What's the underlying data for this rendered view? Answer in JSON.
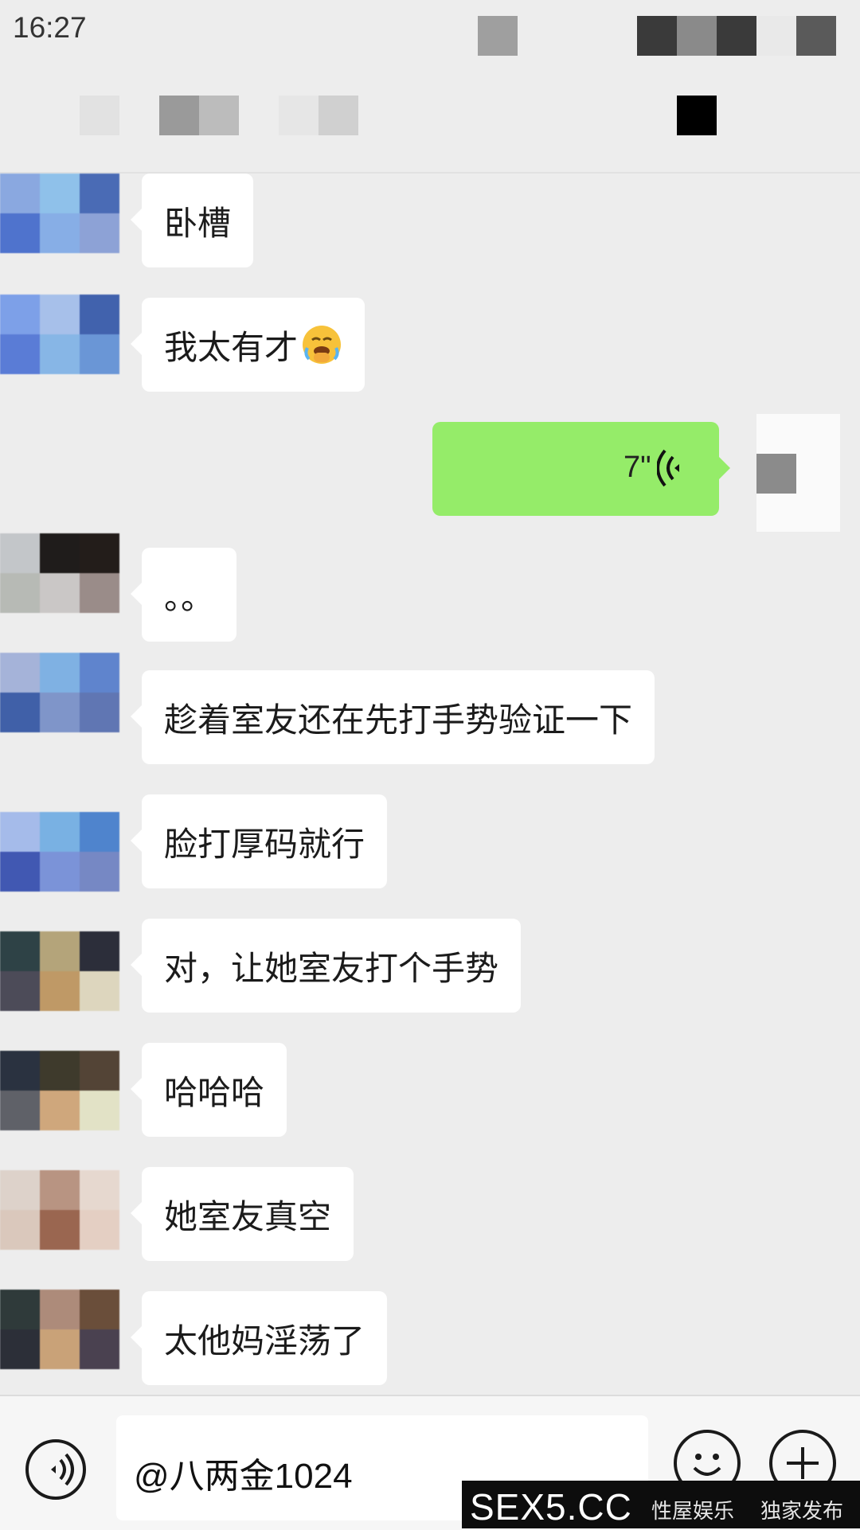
{
  "status_bar": {
    "time": "16:27"
  },
  "messages": [
    {
      "side": "left",
      "text": "卧槽",
      "avatar": [
        "#8aa8e0",
        "#8fc1ea",
        "#4a6bb5",
        "#4f73cd",
        "#87aee6",
        "#8da2d6"
      ]
    },
    {
      "side": "left",
      "text": "我太有才",
      "emoji": "face-with-hand-over-mouth-tears",
      "avatar": [
        "#7da0e8",
        "#a7c0ea",
        "#4162ad",
        "#5a7cd6",
        "#87b6e6",
        "#6a96d6"
      ]
    },
    {
      "side": "right",
      "type": "voice",
      "duration": "7\""
    },
    {
      "side": "left",
      "text": "。。",
      "avatar": [
        "#c3c6c9",
        "#1f1c1b",
        "#231d1a",
        "#b7bab5",
        "#cac7c6",
        "#9a8c89"
      ]
    },
    {
      "side": "left",
      "text": "趁着室友还在先打手势验证一下",
      "avatar": [
        "#a5b3d9",
        "#7fb1e3",
        "#5f84cd",
        "#4060a8",
        "#7f95c9",
        "#6076b3"
      ]
    },
    {
      "side": "left",
      "text": "脸打厚码就行",
      "avatar": [
        "#a5bbea",
        "#79b1e3",
        "#4f84cd",
        "#4158b2",
        "#7b93d8",
        "#7688c4"
      ]
    },
    {
      "side": "left",
      "text": "对，让她室友打个手势",
      "avatar": [
        "#2e4246",
        "#b4a47a",
        "#2c2e3a",
        "#4c4b58",
        "#bf9966",
        "#ddd6be"
      ]
    },
    {
      "side": "left",
      "text": "哈哈哈",
      "avatar": [
        "#2a3240",
        "#3e3a2c",
        "#534436",
        "#5f6168",
        "#cfa77c",
        "#e2e2c6"
      ]
    },
    {
      "side": "left",
      "text": "她室友真空",
      "avatar": [
        "#ddd2ca",
        "#b89482",
        "#e6d8cf",
        "#dac8bc",
        "#9a6650",
        "#e4cfc3"
      ]
    },
    {
      "side": "left",
      "text": "太他妈淫荡了",
      "avatar": [
        "#2f3a3a",
        "#ad8b7a",
        "#6a4e3a",
        "#2c2f38",
        "#c9a278",
        "#4a4150"
      ]
    }
  ],
  "input": {
    "value": "@八两金1024"
  },
  "watermark": {
    "logo": "SEX5.CC",
    "text_a": "性屋娱乐",
    "text_b": "独家发布"
  }
}
